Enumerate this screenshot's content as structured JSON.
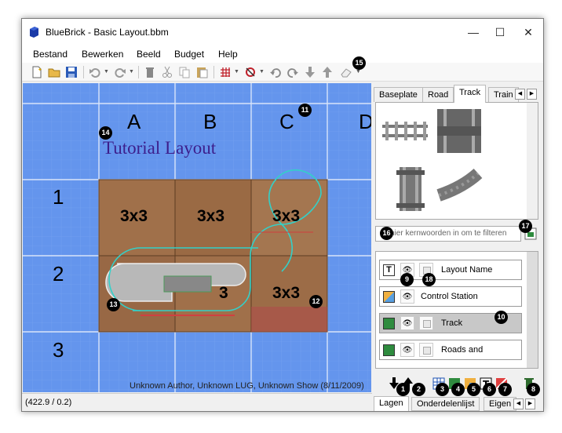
{
  "window": {
    "title": "BlueBrick - Basic Layout.bbm",
    "minimize_glyph": "—",
    "maximize_glyph": "☐",
    "close_glyph": "✕"
  },
  "menu": [
    {
      "label": "Bestand"
    },
    {
      "label": "Bewerken"
    },
    {
      "label": "Beeld"
    },
    {
      "label": "Budget"
    },
    {
      "label": "Help"
    }
  ],
  "toolbar": {
    "icons": [
      "new-file-icon",
      "open-folder-icon",
      "save-icon",
      "undo-icon",
      "redo-icon",
      "delete-icon",
      "cut-icon",
      "copy-icon",
      "paste-icon",
      "snap-grid-icon",
      "paint-icon",
      "rotate-left-icon",
      "rotate-right-icon",
      "send-back-icon",
      "bring-front-icon",
      "eraser-icon"
    ]
  },
  "canvas": {
    "colors": {
      "grid_bg": "#6495ed",
      "grid_line": "#b8cef5",
      "baseplate": "#a0704a"
    },
    "column_labels": [
      "A",
      "B",
      "C",
      "D"
    ],
    "row_labels": [
      "1",
      "2",
      "3"
    ],
    "layout_title": "Tutorial Layout",
    "baseplate_labels": [
      "3x3",
      "3x3",
      "3x3",
      "3x3",
      "3",
      "3x3"
    ],
    "author_text": "Unknown Author, Unknown LUG, Unknown Show (8/11/2009)"
  },
  "status": {
    "coordinates": "(422.9 / 0.2)"
  },
  "parts_panel": {
    "tabs": [
      "Baseplate",
      "Road",
      "Track",
      "Train"
    ],
    "active_tab": "Track",
    "filter_placeholder": "Typ hier kernwoorden in om te filteren",
    "filter_visible": "hier kernwoorden in om te filteren"
  },
  "layers": [
    {
      "name": "Layout Name",
      "icon": "text-layer-icon",
      "selected": false
    },
    {
      "name": "Control Station",
      "icon": "area-layer-icon",
      "selected": false
    },
    {
      "name": "Track",
      "icon": "brick-layer-icon",
      "selected": true
    },
    {
      "name": "Roads and",
      "icon": "brick-layer-icon",
      "selected": false
    }
  ],
  "bottom_tabs": [
    "Lagen",
    "Onderdelenlijst",
    "Eigen"
  ],
  "active_bottom_tab": "Lagen",
  "markers": [
    "1",
    "2",
    "3",
    "4",
    "5",
    "6",
    "7",
    "8",
    "9",
    "10",
    "11",
    "12",
    "13",
    "14",
    "15",
    "16",
    "17",
    "18"
  ]
}
